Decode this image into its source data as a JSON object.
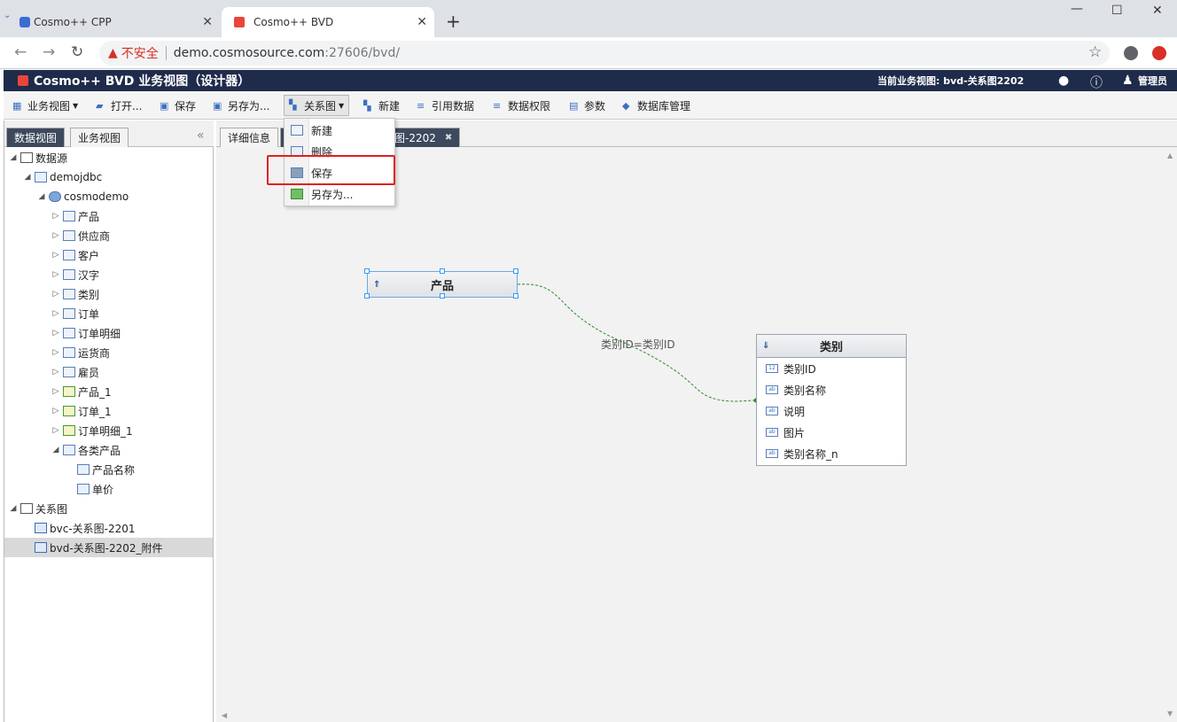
{
  "browser": {
    "tabs": [
      {
        "title": "Cosmo++ CPP",
        "active": false
      },
      {
        "title": "Cosmo++ BVD",
        "active": true
      }
    ],
    "new_tab": "+",
    "url_insecure": "不安全",
    "url_host": "demo.cosmosource.com",
    "url_path": ":27606/bvd/",
    "controls": {
      "back": "←",
      "forward": "→",
      "reload": "↻",
      "minimize": "—",
      "maximize": "☐",
      "close": "✕",
      "star": "☆"
    }
  },
  "app": {
    "title": "Cosmo++ BVD 业务视图（设计器）",
    "current_view": "当前业务视图: bvd-关系图2202",
    "user": "管理员"
  },
  "toolbar": {
    "business_view": "业务视图",
    "open": "打开...",
    "save": "保存",
    "save_as": "另存为...",
    "relation_diagram": "关系图",
    "new": "新建",
    "ref_data": "引用数据",
    "data_permission": "数据权限",
    "params": "参数",
    "db_manage": "数据库管理"
  },
  "left": {
    "tab_data_view": "数据视图",
    "tab_business_view": "业务视图",
    "tree": [
      {
        "label": "数据源",
        "arrow": "◢",
        "icon": "folder"
      },
      {
        "label": "demojdbc",
        "arrow": "◢",
        "icon": "server"
      },
      {
        "label": "cosmodemo",
        "arrow": "◢",
        "icon": "db"
      },
      {
        "label": "产品",
        "arrow": "▷",
        "icon": "grid"
      },
      {
        "label": "供应商",
        "arrow": "▷",
        "icon": "grid"
      },
      {
        "label": "客户",
        "arrow": "▷",
        "icon": "grid"
      },
      {
        "label": "汉字",
        "arrow": "▷",
        "icon": "grid"
      },
      {
        "label": "类别",
        "arrow": "▷",
        "icon": "grid"
      },
      {
        "label": "订单",
        "arrow": "▷",
        "icon": "grid"
      },
      {
        "label": "订单明细",
        "arrow": "▷",
        "icon": "grid"
      },
      {
        "label": "运货商",
        "arrow": "▷",
        "icon": "grid"
      },
      {
        "label": "雇员",
        "arrow": "▷",
        "icon": "grid"
      },
      {
        "label": "产品_1",
        "arrow": "▷",
        "icon": "view"
      },
      {
        "label": "订单_1",
        "arrow": "▷",
        "icon": "view"
      },
      {
        "label": "订单明细_1",
        "arrow": "▷",
        "icon": "view"
      },
      {
        "label": "各类产品",
        "arrow": "◢",
        "icon": "sql"
      },
      {
        "label": "产品名称",
        "arrow": "",
        "icon": "field"
      },
      {
        "label": "单价",
        "arrow": "",
        "icon": "field"
      },
      {
        "label": "关系图",
        "arrow": "◢",
        "icon": "folder"
      },
      {
        "label": "bvc-关系图-2201",
        "arrow": "",
        "icon": "rel"
      },
      {
        "label": "bvd-关系图-2202_附件",
        "arrow": "",
        "icon": "rel"
      }
    ]
  },
  "main": {
    "tab_detail": "详细信息",
    "tab_diagram": "图-2202"
  },
  "diagram": {
    "entity_product": {
      "title": "产品",
      "toggle": "»"
    },
    "entity_category": {
      "title": "类别",
      "toggle": "»",
      "fields": [
        {
          "label": "类别ID",
          "type": "12"
        },
        {
          "label": "类别名称",
          "type": "ab"
        },
        {
          "label": "说明",
          "type": "ab"
        },
        {
          "label": "图片",
          "type": "ab"
        },
        {
          "label": "类别名称_n",
          "type": "ab"
        }
      ]
    },
    "relation_label": "类别ID=类别ID"
  },
  "dropdown": {
    "items": [
      {
        "label": "新建",
        "icon": "new"
      },
      {
        "label": "删除",
        "icon": "del"
      },
      {
        "label": "保存",
        "icon": "save"
      },
      {
        "label": "另存为...",
        "icon": "saveas"
      }
    ]
  },
  "colors": {
    "header_bg": "#1f2b4a",
    "highlight": "#e0211b",
    "active_tab_bg": "#3d4a5d",
    "relation_line": "#2a8a2a"
  }
}
